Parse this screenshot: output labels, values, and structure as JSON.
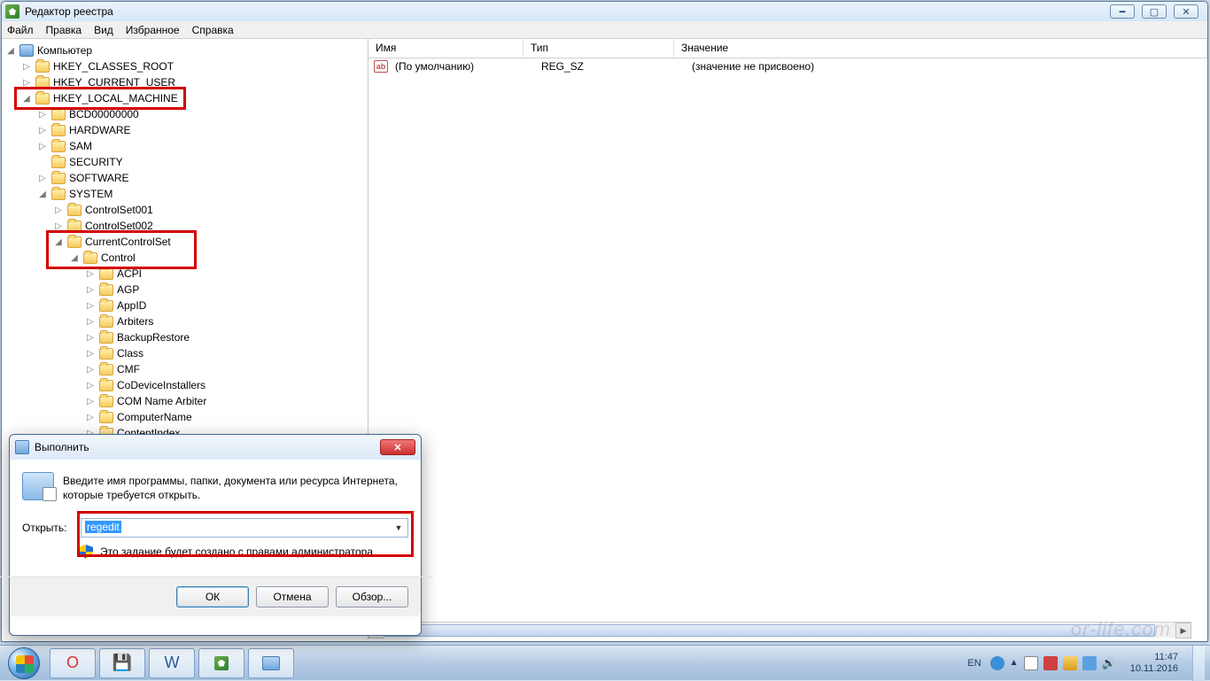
{
  "window": {
    "title": "Редактор реестра",
    "menu": [
      "Файл",
      "Правка",
      "Вид",
      "Избранное",
      "Справка"
    ]
  },
  "tree": {
    "root": "Компьютер",
    "items": [
      {
        "indent": 1,
        "toggle": "▷",
        "label": "HKEY_CLASSES_ROOT"
      },
      {
        "indent": 1,
        "toggle": "▷",
        "label": "HKEY_CURRENT_USER"
      },
      {
        "indent": 1,
        "toggle": "◢",
        "label": "HKEY_LOCAL_MACHINE"
      },
      {
        "indent": 2,
        "toggle": "▷",
        "label": "BCD00000000"
      },
      {
        "indent": 2,
        "toggle": "▷",
        "label": "HARDWARE"
      },
      {
        "indent": 2,
        "toggle": "▷",
        "label": "SAM"
      },
      {
        "indent": 2,
        "toggle": "",
        "label": "SECURITY"
      },
      {
        "indent": 2,
        "toggle": "▷",
        "label": "SOFTWARE"
      },
      {
        "indent": 2,
        "toggle": "◢",
        "label": "SYSTEM"
      },
      {
        "indent": 3,
        "toggle": "▷",
        "label": "ControlSet001"
      },
      {
        "indent": 3,
        "toggle": "▷",
        "label": "ControlSet002"
      },
      {
        "indent": 3,
        "toggle": "◢",
        "label": "CurrentControlSet"
      },
      {
        "indent": 4,
        "toggle": "◢",
        "label": "Control"
      },
      {
        "indent": 5,
        "toggle": "▷",
        "label": "ACPI"
      },
      {
        "indent": 5,
        "toggle": "▷",
        "label": "AGP"
      },
      {
        "indent": 5,
        "toggle": "▷",
        "label": "AppID"
      },
      {
        "indent": 5,
        "toggle": "▷",
        "label": "Arbiters"
      },
      {
        "indent": 5,
        "toggle": "▷",
        "label": "BackupRestore"
      },
      {
        "indent": 5,
        "toggle": "▷",
        "label": "Class"
      },
      {
        "indent": 5,
        "toggle": "▷",
        "label": "CMF"
      },
      {
        "indent": 5,
        "toggle": "▷",
        "label": "CoDeviceInstallers"
      },
      {
        "indent": 5,
        "toggle": "▷",
        "label": "COM Name Arbiter"
      },
      {
        "indent": 5,
        "toggle": "▷",
        "label": "ComputerName"
      },
      {
        "indent": 5,
        "toggle": "▷",
        "label": "ContentIndex"
      }
    ]
  },
  "list": {
    "headers": {
      "name": "Имя",
      "type": "Тип",
      "value": "Значение"
    },
    "row": {
      "name": "(По умолчанию)",
      "type": "REG_SZ",
      "value": "(значение не присвоено)"
    }
  },
  "run": {
    "title": "Выполнить",
    "desc": "Введите имя программы, папки, документа или ресурса Интернета, которые требуется открыть.",
    "open_label": "Открыть:",
    "value": "regedit",
    "admin_note": "Это задание будет создано с правами администратора",
    "ok": "ОК",
    "cancel": "Отмена",
    "browse": "Обзор..."
  },
  "taskbar": {
    "lang": "EN",
    "time": "11:47",
    "date": "10.11.2016"
  },
  "watermark": "or-life.com"
}
